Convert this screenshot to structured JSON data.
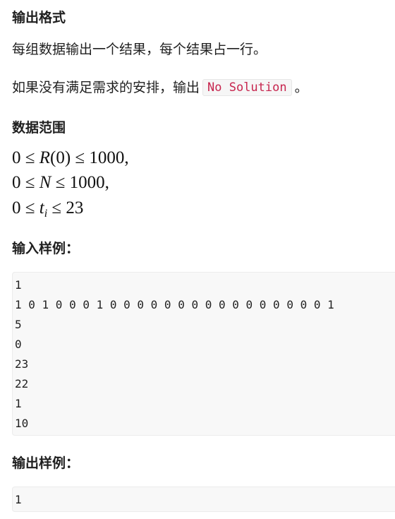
{
  "output_format": {
    "heading": "输出格式",
    "line1": "每组数据输出一个结果，每个结果占一行。",
    "line2_before": "如果没有满足需求的安排，输出",
    "line2_code": "No Solution",
    "line2_after": "。"
  },
  "data_range": {
    "heading": "数据范围",
    "c1_left": "0 ≤ ",
    "c1_var": "R",
    "c1_mid": "(0) ≤ 1000,",
    "c2_left": "0 ≤ ",
    "c2_var": "N",
    "c2_mid": " ≤ 1000,",
    "c3_left": "0 ≤ ",
    "c3_var": "t",
    "c3_sub": "i",
    "c3_mid": " ≤ 23"
  },
  "input_sample": {
    "heading": "输入样例：",
    "lines": [
      "1",
      "1 0 1 0 0 0 1 0 0 0 0 0 0 0 0 0 0 0 0 0 0 0 0 1",
      "5",
      "0",
      "23",
      "22",
      "1",
      "10"
    ]
  },
  "output_sample": {
    "heading": "输出样例：",
    "lines": [
      "1"
    ]
  }
}
